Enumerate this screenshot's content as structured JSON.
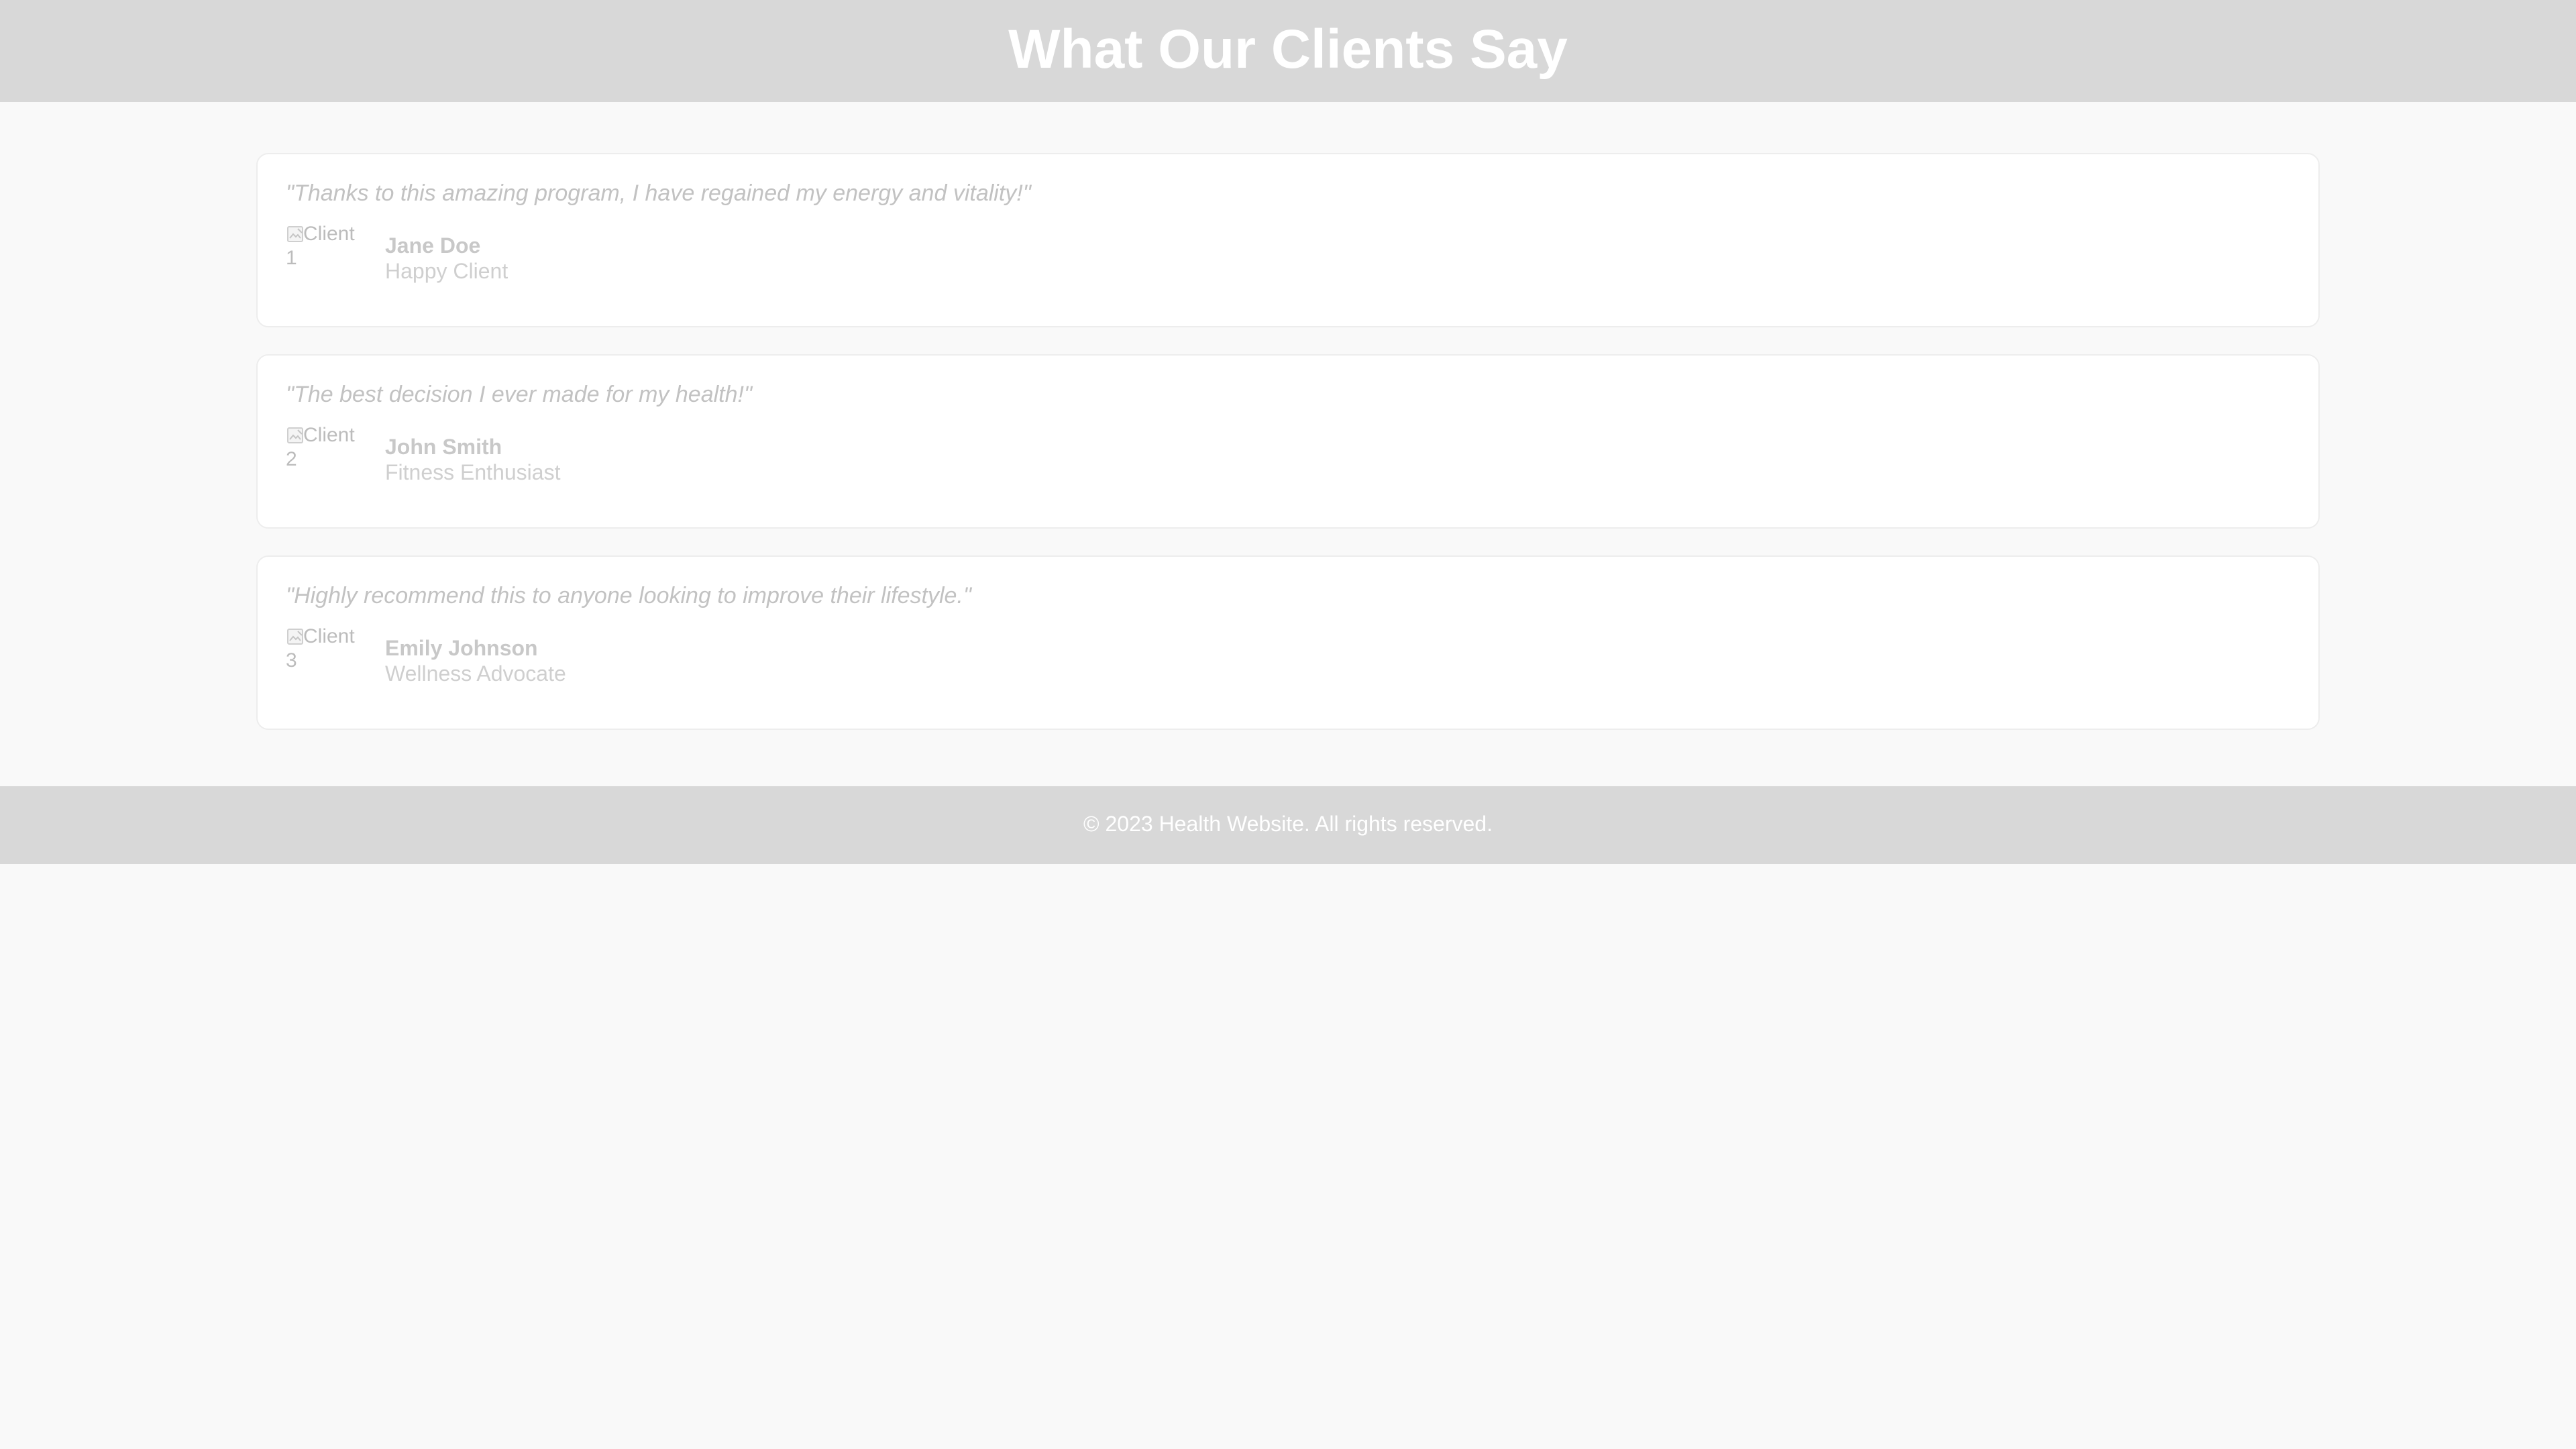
{
  "header": {
    "title": "What Our Clients Say"
  },
  "testimonials": [
    {
      "quote": "\"Thanks to this amazing program, I have regained my energy and vitality!\"",
      "image_alt": "Client 1",
      "name": "Jane Doe",
      "role": "Happy Client"
    },
    {
      "quote": "\"The best decision I ever made for my health!\"",
      "image_alt": "Client 2",
      "name": "John Smith",
      "role": "Fitness Enthusiast"
    },
    {
      "quote": "\"Highly recommend this to anyone looking to improve their lifestyle.\"",
      "image_alt": "Client 3",
      "name": "Emily Johnson",
      "role": "Wellness Advocate"
    }
  ],
  "footer": {
    "text": "© 2023 Health Website. All rights reserved."
  },
  "colors": {
    "header_bg": "#d8d8d8",
    "page_bg": "#f9f9f9",
    "card_bg": "#ffffff",
    "muted_text": "#c2c2c2",
    "title_text": "#ffffff"
  },
  "icons": {
    "broken_image": "broken-image-icon"
  }
}
